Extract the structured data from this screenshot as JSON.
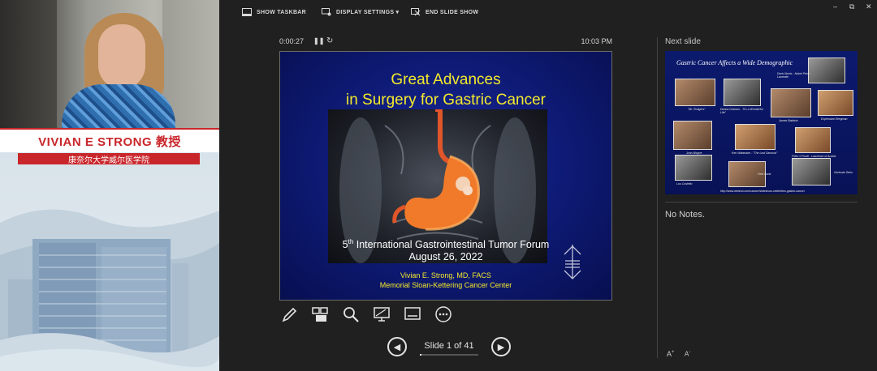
{
  "speaker": {
    "name": "VIVIAN E STRONG  教授",
    "affiliation": "康奈尔大学威尔医学院"
  },
  "topbar": {
    "show_taskbar": "SHOW TASKBAR",
    "display_settings": "DISPLAY SETTINGS ▾",
    "end_slide_show": "END SLIDE SHOW"
  },
  "timer": {
    "elapsed": "0:00:27",
    "pause_icon": "pause-icon",
    "reset_icon": "reset-icon",
    "clock": "10:03 PM"
  },
  "current_slide": {
    "title_line1": "Great Advances",
    "title_line2": "in Surgery for Gastric Cancer",
    "event_ordinal": "5",
    "event_sup": "th",
    "event_rest": " International Gastrointestinal Tumor Forum",
    "event_date": "August 26, 2022",
    "author": "Vivian E. Strong, MD, FACS",
    "institution": "Memorial Sloan-Kettering Cancer Center"
  },
  "tools": [
    "pen-icon",
    "see-all-slides-icon",
    "zoom-icon",
    "laser-pointer-icon",
    "subtitles-icon",
    "more-options-icon"
  ],
  "navigation": {
    "counter": "Slide 1 of 41",
    "progress_fraction": 0.024
  },
  "next_slide": {
    "label": "Next slide",
    "title": "Gastric Cancer Affects a Wide Demographic",
    "captions": [
      "Doris Norris - Nobel Prize Laureate",
      "\"Mr. Rodgers\"",
      "Donna Graham - \"It's a Wonderful Life\"",
      "James Baldwin",
      "Expression Bregman",
      "John Wayne",
      "Ken Watanabe - \"The Last Samurai\"",
      "Peter O'Toole - Lawrence of Arabia",
      "Lou Costello",
      "Fred Soria",
      "Gertrude Stein"
    ],
    "url": "http://www.webmd.com/cancer/slideshow-celebrities-gastric-cancer"
  },
  "notes": {
    "text": "No Notes."
  },
  "font_controls": {
    "increase": "A",
    "decrease": "A"
  }
}
